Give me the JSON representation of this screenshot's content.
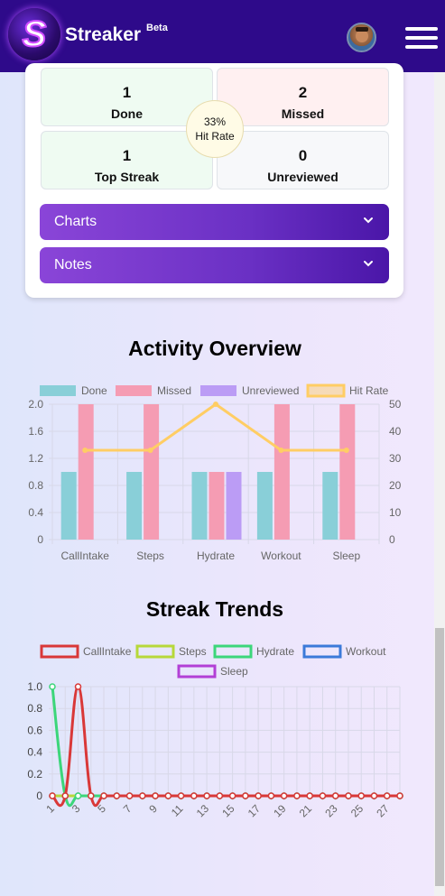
{
  "header": {
    "brand": "Streaker",
    "beta": "Beta",
    "logo_letter": "S",
    "avatar_icon": "user-avatar",
    "menu_icon": "hamburger-menu-icon"
  },
  "stats": {
    "done": {
      "value": "1",
      "label": "Done"
    },
    "missed": {
      "value": "2",
      "label": "Missed"
    },
    "top_streak": {
      "value": "1",
      "label": "Top Streak"
    },
    "unreviewed": {
      "value": "0",
      "label": "Unreviewed"
    },
    "hit_rate": {
      "value": "33%",
      "label": "Hit Rate"
    }
  },
  "accordions": [
    {
      "label": "Charts"
    },
    {
      "label": "Notes"
    }
  ],
  "colors": {
    "header": "#2e0a8a",
    "done": "#89cfd8",
    "missed": "#f59cb3",
    "unreviewed": "#bb9cf5",
    "hit_rate": "#ffcd64",
    "callintake": "#d93838",
    "steps": "#b7d83a",
    "hydrate": "#3cd67a",
    "workout": "#3b7ad9",
    "sleep": "#b240d6"
  },
  "chart_data": [
    {
      "type": "bar",
      "title": "Activity Overview",
      "categories": [
        "CallIntake",
        "Steps",
        "Hydrate",
        "Workout",
        "Sleep"
      ],
      "series": [
        {
          "name": "Done",
          "values": [
            1,
            1,
            1,
            1,
            1
          ]
        },
        {
          "name": "Missed",
          "values": [
            2,
            2,
            1,
            2,
            2
          ]
        },
        {
          "name": "Unreviewed",
          "values": [
            0,
            0,
            1,
            0,
            0
          ]
        },
        {
          "name": "Hit Rate",
          "type": "line",
          "axis": "right",
          "values": [
            33,
            33,
            50,
            33,
            33
          ]
        }
      ],
      "ylim": [
        0,
        2
      ],
      "y_ticks": [
        "0",
        "0.4",
        "0.8",
        "1.2",
        "1.6",
        "2.0"
      ],
      "y2lim": [
        0,
        50
      ],
      "y2_ticks": [
        "0",
        "10",
        "20",
        "30",
        "40",
        "50"
      ],
      "legend": "top",
      "grid": true
    },
    {
      "type": "line",
      "title": "Streak Trends",
      "x": [
        1,
        2,
        3,
        4,
        5,
        6,
        7,
        8,
        9,
        10,
        11,
        12,
        13,
        14,
        15,
        16,
        17,
        18,
        19,
        20,
        21,
        22,
        23,
        24,
        25,
        26,
        27,
        28
      ],
      "x_ticks": [
        "1",
        "3",
        "5",
        "7",
        "9",
        "11",
        "13",
        "15",
        "17",
        "19",
        "21",
        "23",
        "25",
        "27"
      ],
      "series": [
        {
          "name": "CallIntake",
          "values": [
            0,
            0,
            1,
            0,
            0,
            0,
            0,
            0,
            0,
            0,
            0,
            0,
            0,
            0,
            0,
            0,
            0,
            0,
            0,
            0,
            0,
            0,
            0,
            0,
            0,
            0,
            0,
            0
          ]
        },
        {
          "name": "Steps",
          "values": [
            0,
            0,
            0,
            0,
            0,
            0,
            0,
            0,
            0,
            0,
            0,
            0,
            0,
            0,
            0,
            0,
            0,
            0,
            0,
            0,
            0,
            0,
            0,
            0,
            0,
            0,
            0,
            0
          ]
        },
        {
          "name": "Hydrate",
          "values": [
            1,
            0,
            0,
            0,
            0,
            0,
            0,
            0,
            0,
            0,
            0,
            0,
            0,
            0,
            0,
            0,
            0,
            0,
            0,
            0,
            0,
            0,
            0,
            0,
            0,
            0,
            0,
            0
          ]
        },
        {
          "name": "Workout",
          "values": [
            0,
            0,
            0,
            0,
            0,
            0,
            0,
            0,
            0,
            0,
            0,
            0,
            0,
            0,
            0,
            0,
            0,
            0,
            0,
            0,
            0,
            0,
            0,
            0,
            0,
            0,
            0,
            0
          ]
        },
        {
          "name": "Sleep",
          "values": [
            0,
            0,
            0,
            0,
            0,
            0,
            0,
            0,
            0,
            0,
            0,
            0,
            0,
            0,
            0,
            0,
            0,
            0,
            0,
            0,
            0,
            0,
            0,
            0,
            0,
            0,
            0,
            0
          ]
        }
      ],
      "ylim": [
        0,
        1
      ],
      "y_ticks": [
        "0",
        "0.2",
        "0.4",
        "0.6",
        "0.8",
        "1.0"
      ],
      "legend": "top",
      "grid": true
    }
  ]
}
